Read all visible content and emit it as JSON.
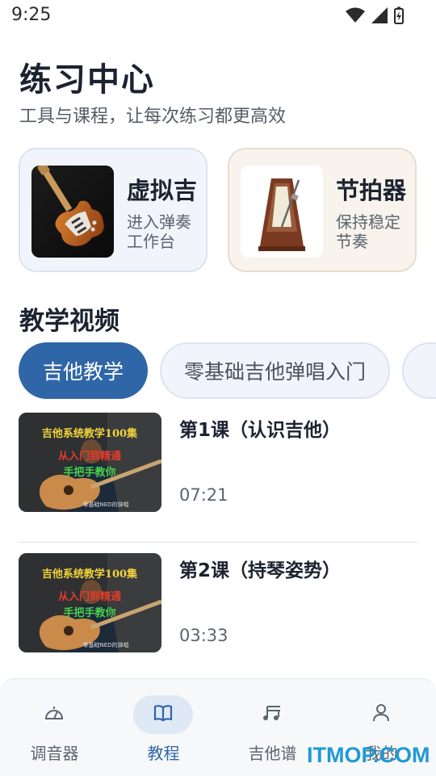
{
  "status_bar": {
    "time": "9:25",
    "icons": [
      "wifi-icon",
      "signal-icon",
      "battery-icon"
    ]
  },
  "header": {
    "title": "练习中心",
    "subtitle": "工具与课程，让每次练习都更高效"
  },
  "tools": [
    {
      "title": "虚拟吉",
      "desc": "进入弹奏工作台",
      "icon": "electric-guitar-image"
    },
    {
      "title": "节拍器",
      "desc": "保持稳定节奏",
      "icon": "metronome-image"
    }
  ],
  "section": {
    "title": "教学视频"
  },
  "categories": [
    {
      "label": "吉他教学",
      "active": true
    },
    {
      "label": "零基础吉他弹唱入门",
      "active": false
    },
    {
      "label": "",
      "active": false
    }
  ],
  "videos": [
    {
      "title": "第1课（认识吉他）",
      "duration": "07:21",
      "thumb_line1": "吉他系统教学100集",
      "thumb_line2": "从入门到精通",
      "thumb_line3": "手把手教你",
      "thumb_footer": "零基础NED的弹唱"
    },
    {
      "title": "第2课（持琴姿势）",
      "duration": "03:33",
      "thumb_line1": "吉他系统教学100集",
      "thumb_line2": "从入门到精通",
      "thumb_line3": "手把手教你",
      "thumb_footer": "零基础NED的弹唱"
    }
  ],
  "bottom_nav": [
    {
      "label": "调音器",
      "icon": "tuner-icon",
      "active": false
    },
    {
      "label": "教程",
      "icon": "book-icon",
      "active": true
    },
    {
      "label": "吉他谱",
      "icon": "music-note-icon",
      "active": false
    },
    {
      "label": "我的",
      "icon": "user-icon",
      "active": false
    }
  ],
  "colors": {
    "accent": "#2f66a7",
    "card_blue": "#f1f5fb",
    "card_beige": "#f8f3ec"
  },
  "watermark": "ITMOP.COM"
}
